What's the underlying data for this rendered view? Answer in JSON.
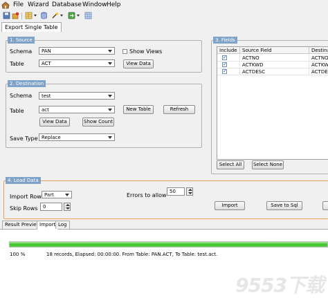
{
  "menu": [
    "File",
    "Wizard",
    "Database",
    "Window",
    "Help"
  ],
  "toolbar_icons": [
    "save-icon",
    "plugin-icon",
    "table-icon",
    "wand-icon",
    "export-icon",
    "grid-icon"
  ],
  "main_tab": "Export Single Table",
  "source": {
    "title": "1. Source",
    "schema_label": "Schema",
    "schema_value": "PAN",
    "table_label": "Table",
    "table_value": "ACT",
    "show_views_label": "Show Views",
    "view_data_label": "View Data"
  },
  "destination": {
    "title": "2. Destination",
    "schema_label": "Schema",
    "schema_value": "test",
    "table_label": "Table",
    "table_value": "act",
    "new_table_label": "New Table",
    "refresh_label": "Refresh",
    "view_data_label": "View Data",
    "show_count_label": "Show Count",
    "save_type_label": "Save Type",
    "save_type_value": "Replace"
  },
  "fields": {
    "title": "3. Fields",
    "columns": [
      "Include",
      "Source Field",
      "Destinati"
    ],
    "rows": [
      {
        "include": true,
        "source": "ACTNO",
        "dest": "ACTNO"
      },
      {
        "include": true,
        "source": "ACTKWD",
        "dest": "ACTKWD"
      },
      {
        "include": true,
        "source": "ACTDESC",
        "dest": "ACTDES"
      }
    ],
    "select_all_label": "Select All",
    "select_none_label": "Select None"
  },
  "load": {
    "title": "4. Load Data",
    "import_rows_label": "Import Rows",
    "import_rows_value": "Part",
    "errors_label": "Errors to allow",
    "errors_value": "50",
    "skip_rows_label": "Skip Rows",
    "skip_rows_value": "0",
    "import_label": "Import",
    "save_to_sql_label": "Save to Sql"
  },
  "bottom_tabs": [
    "Result Preview",
    "Import",
    "Log"
  ],
  "active_bottom_tab": "Import",
  "progress": {
    "fraction": 1.0,
    "color": "#3ec02c"
  },
  "status": {
    "percent": "100 %",
    "message": "18 records,   Elapsed: 00:00:00.    From Table: PAN.ACT,    To Table: test.act."
  },
  "watermark": "9553下载"
}
